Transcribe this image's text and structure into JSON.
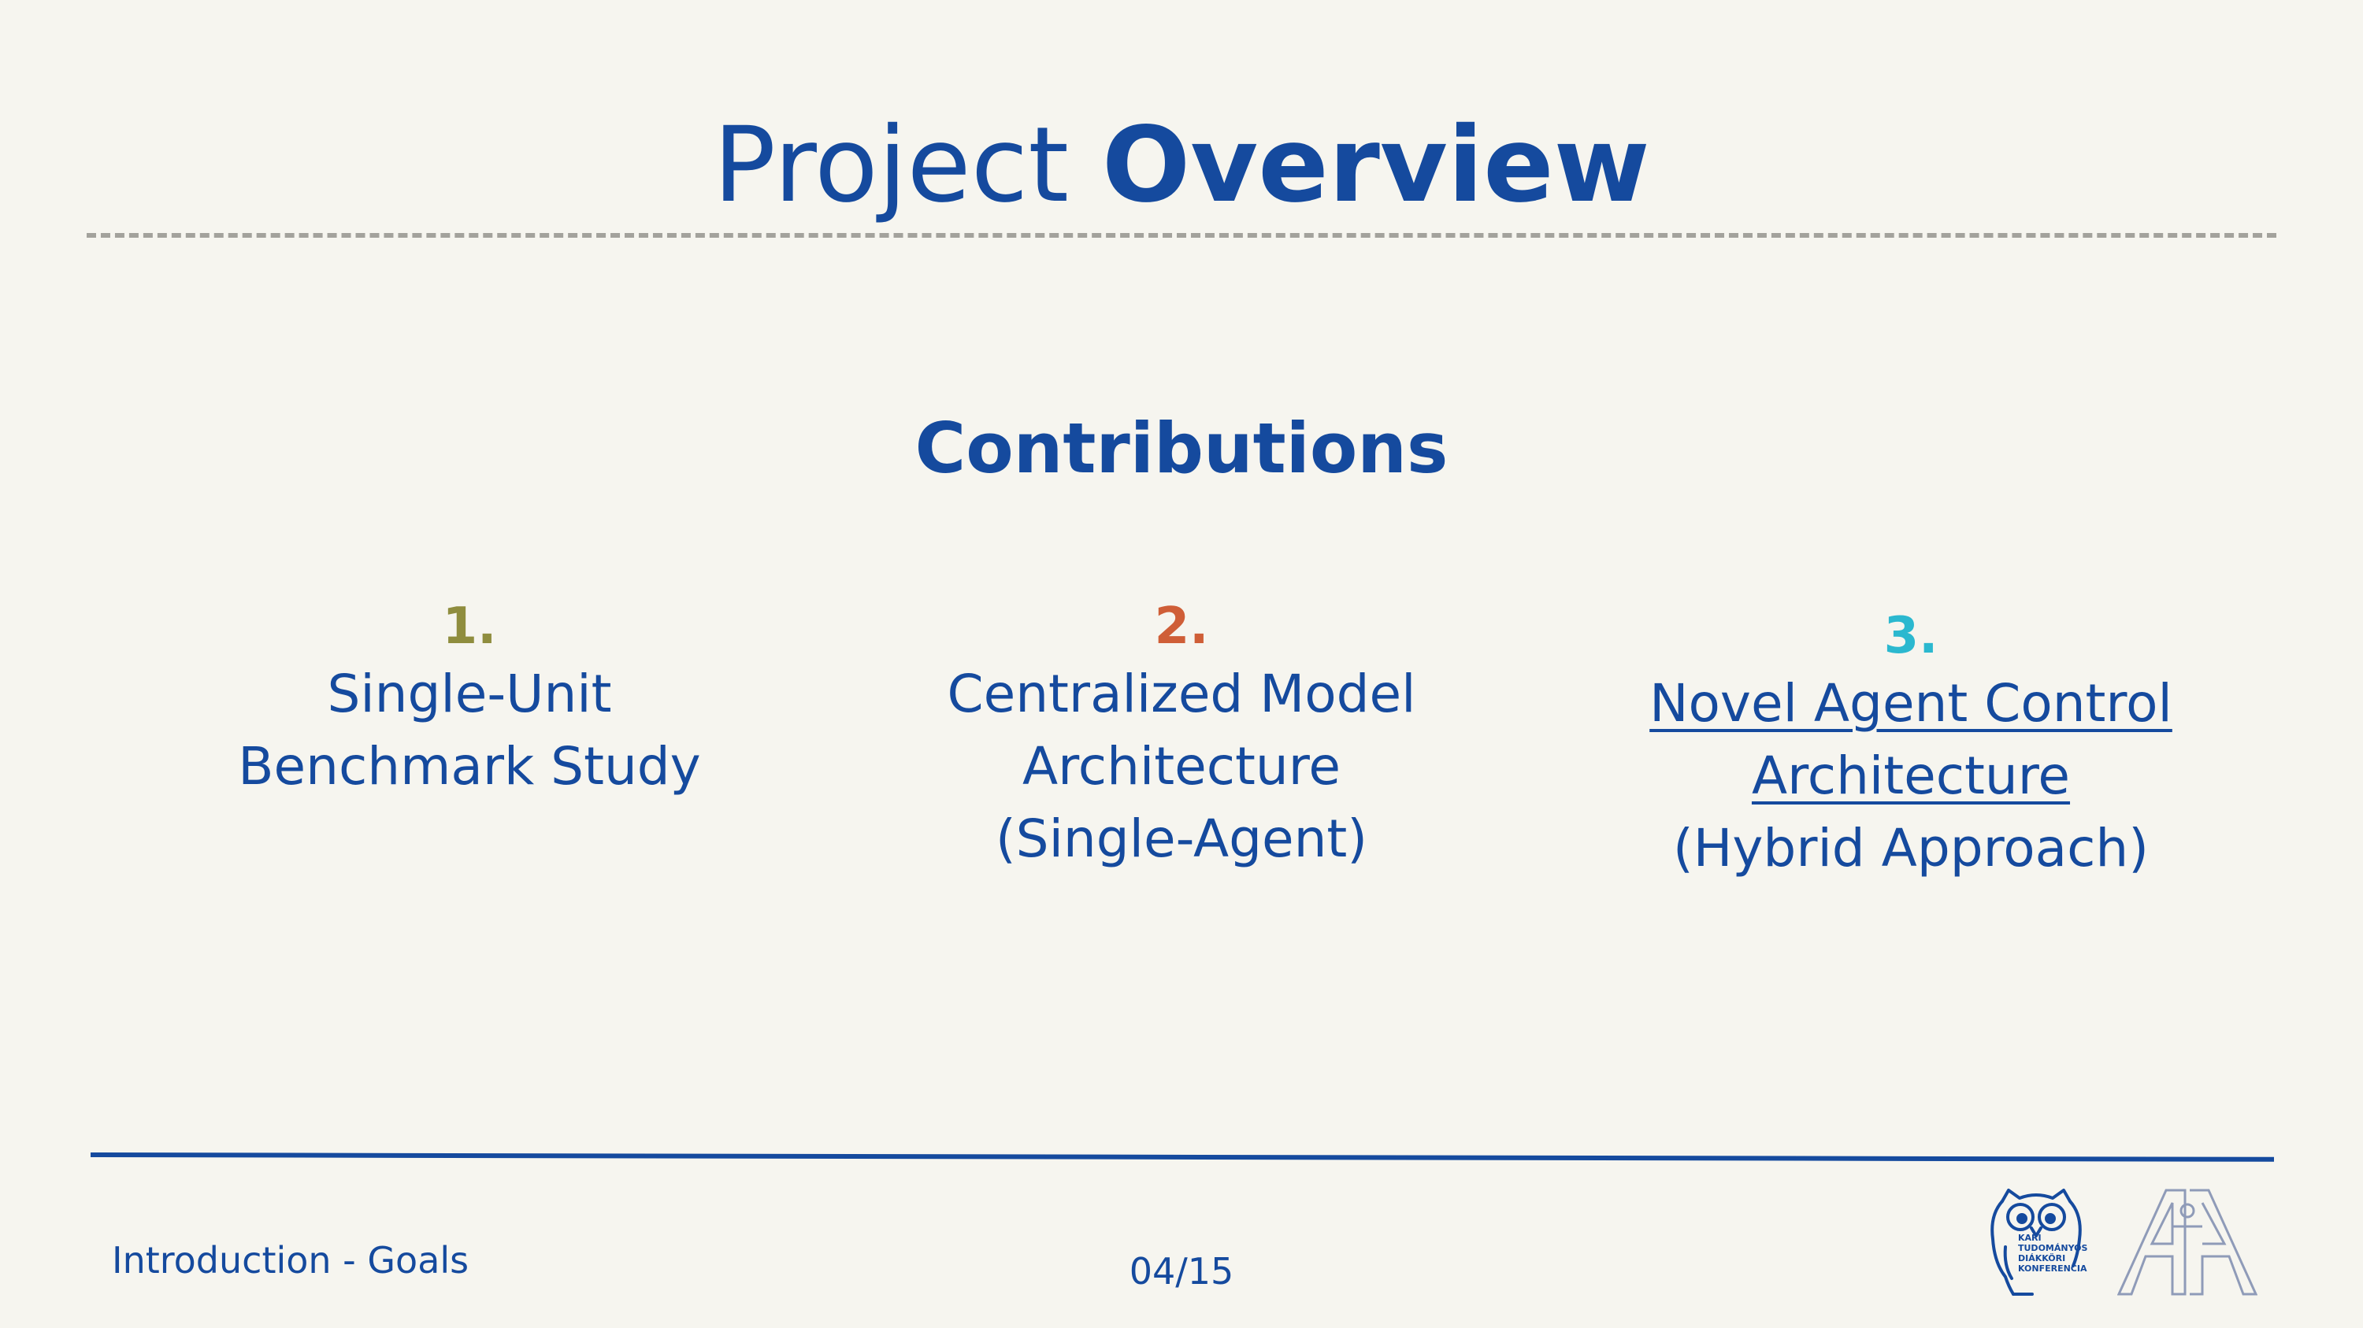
{
  "title": {
    "light": "Project",
    "bold": "Overview"
  },
  "section_heading": "Contributions",
  "items": [
    {
      "number": "1.",
      "number_color": "#8f8d3e",
      "lines": [
        "Single-Unit",
        "Benchmark Study"
      ]
    },
    {
      "number": "2.",
      "number_color": "#cf5e37",
      "lines": [
        "Centralized Model",
        "Architecture",
        "(Single-Agent)"
      ]
    },
    {
      "number": "3.",
      "number_color": "#2bb8cf",
      "lines": [
        "Novel Agent Control",
        "Architecture",
        "(Hybrid Approach)"
      ]
    }
  ],
  "footer": {
    "section": "Introduction - Goals",
    "page": "04/15",
    "owl_logo_text": [
      "KARI",
      "TUDOMÁNYOS",
      "DIÁKKÖRI",
      "KONFERENCIA"
    ]
  },
  "colors": {
    "primary": "#154a9e",
    "background": "#f6f5ef",
    "dash": "#a3a29c"
  }
}
